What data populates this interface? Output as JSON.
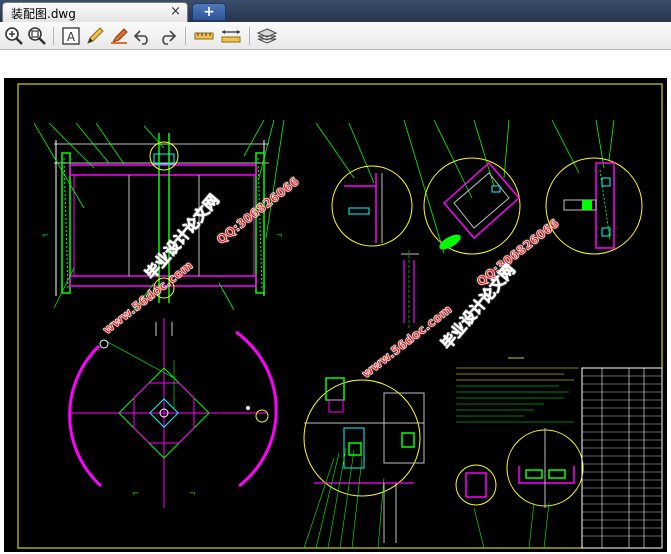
{
  "tab": {
    "title": "装配图.dwg",
    "close": "×",
    "new": "+"
  },
  "toolbar": {
    "buttons": [
      "zoom-in-icon",
      "zoom-window-icon",
      "text-icon",
      "pencil-icon",
      "highlighter-icon",
      "undo-icon",
      "redo-icon",
      "measure-icon",
      "dimension-icon",
      "layers-icon"
    ]
  },
  "watermarks": [
    {
      "text": "毕业设计论文网"
    },
    {
      "text": "QQ:306826066"
    },
    {
      "text": "www.56doc.com"
    },
    {
      "text": "QQ:306826066"
    },
    {
      "text": "www.56doc.com"
    },
    {
      "text": "毕业设计论文网"
    }
  ],
  "colors": {
    "tabbar": "#27354d",
    "cad_bg": "#000000",
    "frame": "#ffff00",
    "magenta": "#ff00ff",
    "green": "#00ff00",
    "cyan": "#00ffff",
    "red": "#ff1a1a"
  }
}
